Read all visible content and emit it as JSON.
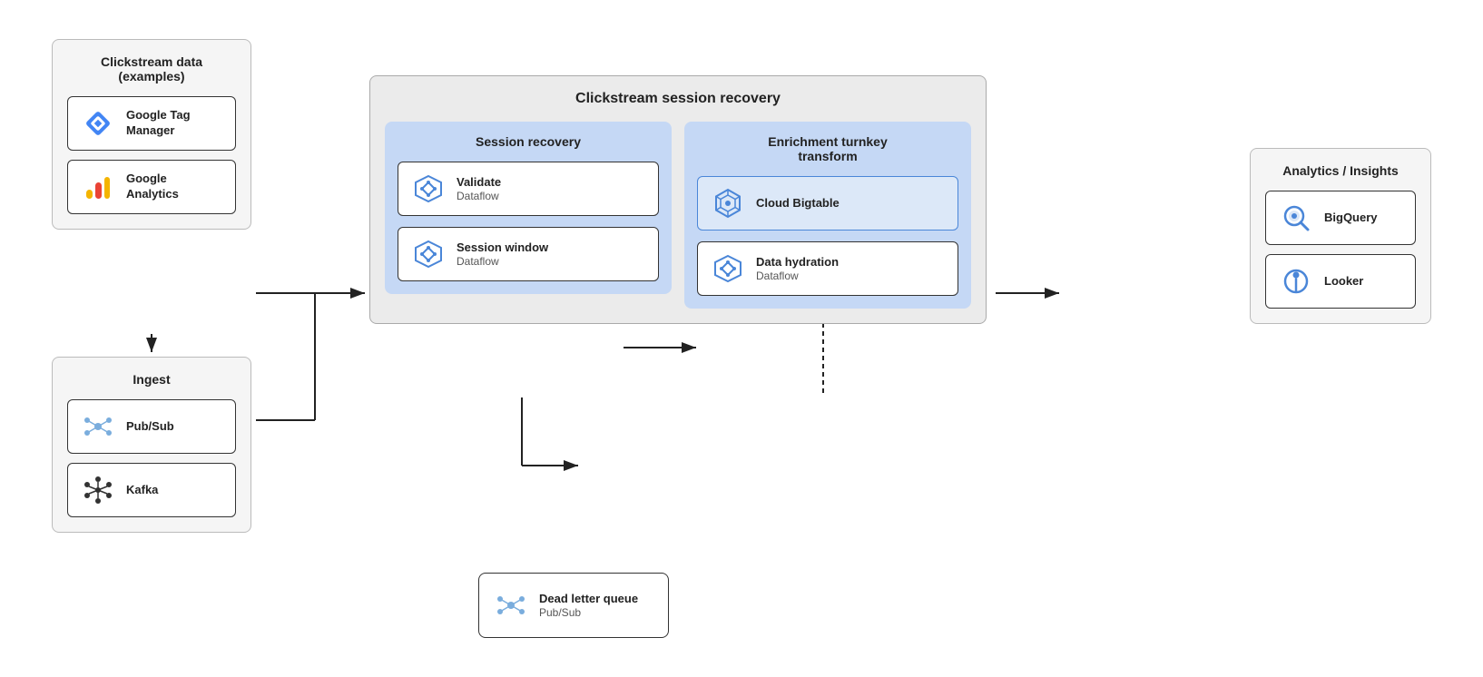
{
  "clickstream": {
    "title": "Clickstream data\n(examples)",
    "items": [
      {
        "id": "gtm",
        "label": "Google Tag\nManager",
        "sublabel": ""
      },
      {
        "id": "ga",
        "label": "Google\nAnalytics",
        "sublabel": ""
      }
    ]
  },
  "ingest": {
    "title": "Ingest",
    "items": [
      {
        "id": "pubsub1",
        "label": "Pub/Sub",
        "sublabel": ""
      },
      {
        "id": "kafka",
        "label": "Kafka",
        "sublabel": ""
      }
    ]
  },
  "session_recovery": {
    "outer_title": "Clickstream session recovery",
    "session_title": "Session recovery",
    "enrichment_title": "Enrichment turnkey\ntransform",
    "session_items": [
      {
        "id": "validate",
        "label": "Validate",
        "sublabel": "Dataflow"
      },
      {
        "id": "session_window",
        "label": "Session window",
        "sublabel": "Dataflow"
      }
    ],
    "enrichment_items": [
      {
        "id": "cloud_bigtable",
        "label": "Cloud\nBigtable",
        "sublabel": ""
      },
      {
        "id": "data_hydration",
        "label": "Data hydration",
        "sublabel": "Dataflow"
      }
    ]
  },
  "dead_letter": {
    "label": "Dead letter queue",
    "sublabel": "Pub/Sub"
  },
  "analytics": {
    "title": "Analytics / Insights",
    "items": [
      {
        "id": "bigquery",
        "label": "BigQuery",
        "sublabel": ""
      },
      {
        "id": "looker",
        "label": "Looker",
        "sublabel": ""
      }
    ]
  },
  "arrows": {
    "color": "#222"
  }
}
